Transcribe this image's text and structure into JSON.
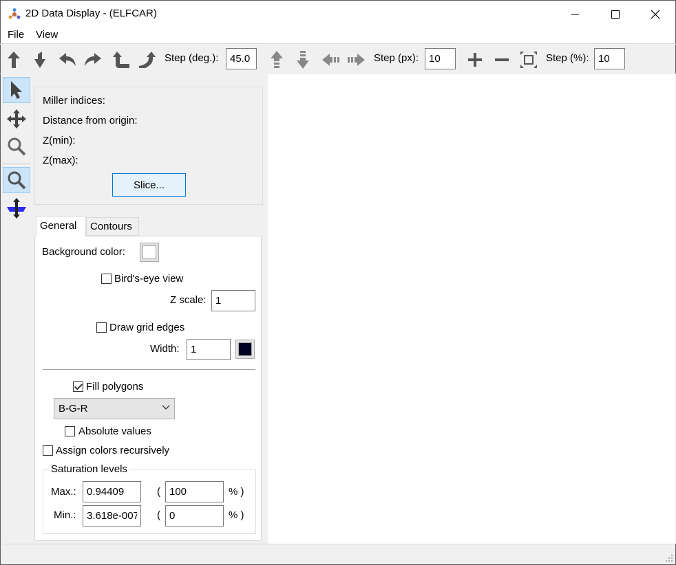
{
  "window": {
    "title": "2D Data Display - (ELFCAR)",
    "minimize_icon": "minimize-icon",
    "maximize_icon": "maximize-icon",
    "close_icon": "close-icon"
  },
  "menu": {
    "items": [
      "File",
      "View"
    ]
  },
  "toolbar": {
    "rotate_step_label": "Step (deg.):",
    "rotate_step_value": "45.0",
    "translate_step_label": "Step (px):",
    "translate_step_value": "10",
    "zoom_step_label": "Step (%):",
    "zoom_step_value": "10",
    "icons": [
      "rotate-up-icon",
      "rotate-down-icon",
      "rotate-left-icon",
      "rotate-right-icon",
      "rotate-ccw-icon",
      "rotate-cw-icon",
      "move-up-icon",
      "move-down-icon",
      "move-left-icon",
      "move-right-icon",
      "zoom-in-icon",
      "zoom-out-icon",
      "fit-view-icon"
    ]
  },
  "left_tools": {
    "icons": [
      "select-arrow-icon",
      "pan-move-icon",
      "zoom-icon",
      "zoom-active-icon",
      "slice-plane-icon"
    ]
  },
  "slice_panel": {
    "miller_label": "Miller indices:",
    "distance_label": "Distance from origin:",
    "zmin_label": "Z(min):",
    "zmax_label": "Z(max):",
    "slice_button": "Slice..."
  },
  "tabs": [
    "General",
    "Contours"
  ],
  "general": {
    "background_color_label": "Background color:",
    "background_color": "#ffffff",
    "birds_eye_label": "Bird's-eye view",
    "birds_eye_checked": false,
    "zscale_label": "Z scale:",
    "zscale_value": "1",
    "draw_grid_label": "Draw grid edges",
    "draw_grid_checked": false,
    "width_label": "Width:",
    "width_value": "1",
    "grid_color": "#000022",
    "fill_polygons_label": "Fill polygons",
    "fill_polygons_checked": true,
    "colormap_selected": "B-G-R",
    "absolute_values_label": "Absolute values",
    "absolute_values_checked": false,
    "assign_recursive_label": "Assign colors recursively",
    "assign_recursive_checked": false,
    "saturation": {
      "title": "Saturation levels",
      "max_label": "Max.:",
      "max_value": "0.94409",
      "max_percent": "100",
      "min_label": "Min.:",
      "min_value": "3.618e-007",
      "min_percent": "0",
      "open_paren": "(",
      "percent_close": "% )"
    }
  }
}
